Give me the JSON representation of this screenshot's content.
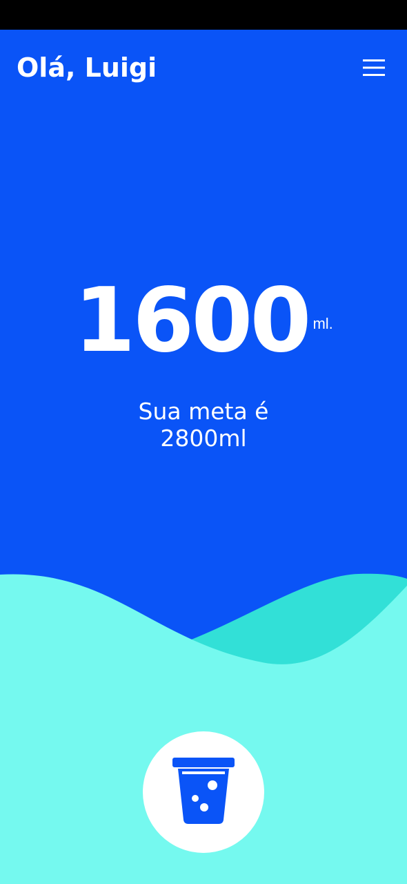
{
  "header": {
    "greeting": "Olá, Luigi",
    "menu_icon": "hamburger-menu-icon"
  },
  "intake": {
    "consumed": "1600",
    "unit": "ml.",
    "goal_line1": "Sua meta é",
    "goal_line2": "2800ml"
  },
  "action": {
    "icon": "water-glass-icon"
  },
  "colors": {
    "background": "#0a54f7",
    "wave_light": "#75f9ef",
    "wave_dark": "#32e0d7",
    "button_bg": "#ffffff",
    "icon_color": "#0a54f7"
  }
}
